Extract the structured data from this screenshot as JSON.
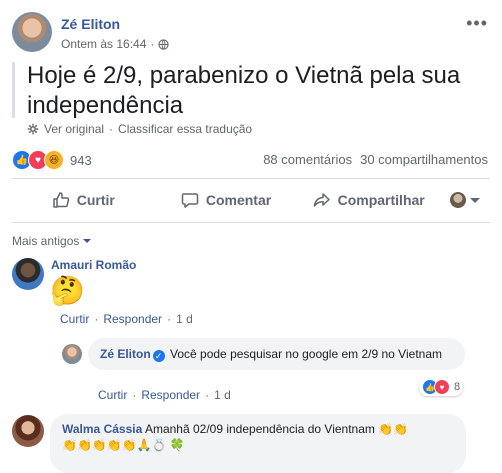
{
  "post": {
    "author": "Zé Eliton",
    "timestamp": "Ontem às 16:44",
    "text": "Hoje é 2/9, parabenizo o Vietnã pela sua independência",
    "see_original": "Ver original",
    "rate_translation": "Classificar essa tradução",
    "reaction_count": "943",
    "comments_count": "88 comentários",
    "shares_count": "30 compartilhamentos"
  },
  "actions": {
    "like": "Curtir",
    "comment": "Comentar",
    "share": "Compartilhar"
  },
  "comments": {
    "sort_label": "Mais antigos",
    "items": [
      {
        "author": "Amauri Romão",
        "text": "🤔",
        "like": "Curtir",
        "reply": "Responder",
        "time": "1 d"
      },
      {
        "author": "Zé Eliton",
        "text": "Você pode pesquisar no google em 2/9 no Vietnam",
        "like": "Curtir",
        "reply": "Responder",
        "time": "1 d",
        "reaction_count": "8"
      },
      {
        "author": "Walma Cássia",
        "text": "Amanhã 02/09 independência do Vientnam 👏👏",
        "text_line2": "👏👏👏👏👏🙏💍 🍀"
      }
    ]
  },
  "colors": {
    "link": "#385898",
    "secondary": "#606770",
    "like_blue": "#1877f2",
    "love_red": "#f33e58",
    "haha_yellow": "#f7b125"
  }
}
